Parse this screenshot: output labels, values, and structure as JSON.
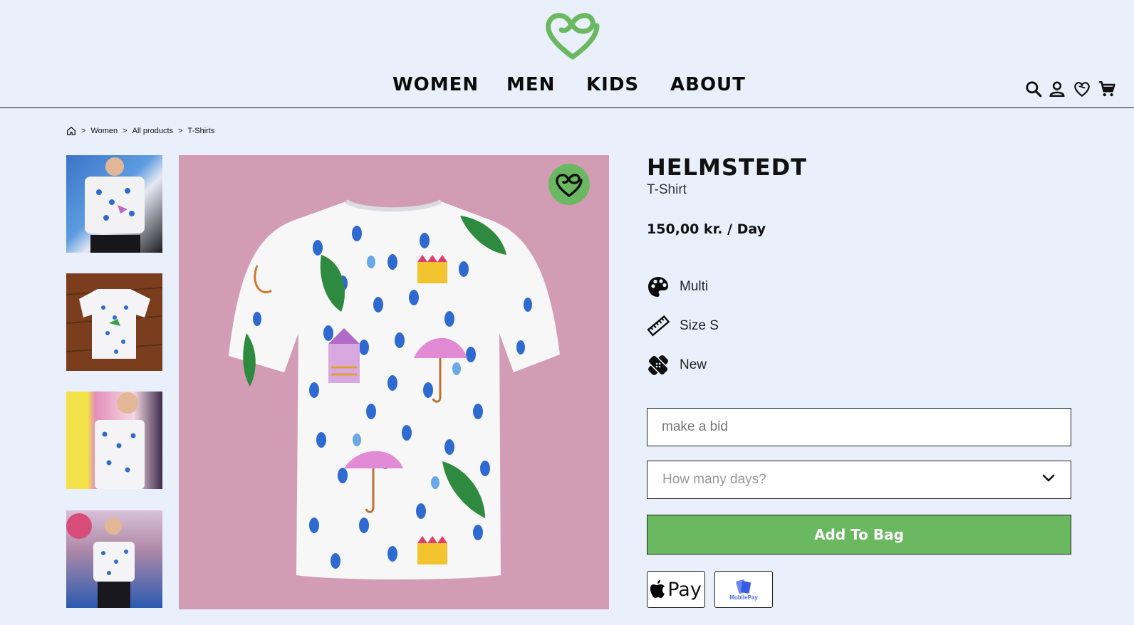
{
  "brand": {
    "logo_icon": "infinity-heart-logo",
    "accent": "#6ab85f"
  },
  "nav": {
    "items": [
      "WOMEN",
      "MEN",
      "KIDS",
      "ABOUT"
    ]
  },
  "header_icons": [
    "search-icon",
    "user-icon",
    "wishlist-heart-icon",
    "cart-icon"
  ],
  "breadcrumb": {
    "home_icon": "home-icon",
    "items": [
      "Women",
      "All products",
      "T-Shirts"
    ],
    "separator": ">"
  },
  "product": {
    "name": "HELMSTEDT",
    "type": "T-Shirt",
    "price": "150,00 kr. / Day",
    "attributes": [
      {
        "icon": "palette-icon",
        "label": "Multi"
      },
      {
        "icon": "ruler-icon",
        "label": "Size S"
      },
      {
        "icon": "bandage-icon",
        "label": "New"
      }
    ],
    "image_background": "#d29db4"
  },
  "bid": {
    "placeholder": "make a bid"
  },
  "days_select": {
    "placeholder": "How many days?"
  },
  "cta": {
    "add_to_bag": "Add To Bag"
  },
  "payments": {
    "apple_pay": "Pay",
    "mobile_pay": "MobilePay"
  },
  "thumbnails": [
    "thumbnail-1",
    "thumbnail-2",
    "thumbnail-3",
    "thumbnail-4"
  ]
}
